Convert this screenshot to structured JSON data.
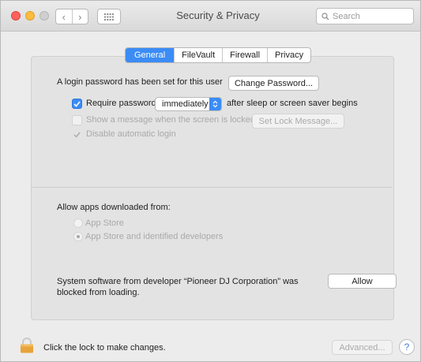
{
  "window": {
    "title": "Security & Privacy",
    "search_placeholder": "Search"
  },
  "tabs": [
    {
      "label": "General",
      "active": true
    },
    {
      "label": "FileVault",
      "active": false
    },
    {
      "label": "Firewall",
      "active": false
    },
    {
      "label": "Privacy",
      "active": false
    }
  ],
  "general": {
    "login_password_text": "A login password has been set for this user",
    "change_password_label": "Change Password...",
    "require_password": {
      "label": "Require password",
      "checked": true
    },
    "require_password_delay": "immediately",
    "after_sleep_text": "after sleep or screen saver begins",
    "show_message": {
      "label": "Show a message when the screen is locked",
      "checked": false,
      "enabled": false
    },
    "set_lock_message_label": "Set Lock Message...",
    "disable_auto_login": {
      "label": "Disable automatic login",
      "checked": true,
      "enabled": false
    }
  },
  "downloads": {
    "heading": "Allow apps downloaded from:",
    "options": [
      {
        "label": "App Store",
        "selected": false
      },
      {
        "label": "App Store and identified developers",
        "selected": true
      }
    ]
  },
  "blocked": {
    "line1": "System software from developer “Pioneer DJ Corporation” was",
    "line2": "blocked from loading.",
    "allow_label": "Allow"
  },
  "footer": {
    "lock_text": "Click the lock to make changes.",
    "advanced_label": "Advanced...",
    "help_label": "?"
  },
  "colors": {
    "accent": "#3b8cf5",
    "close": "#fc605c",
    "minimize": "#fdbc40",
    "lock": "#e8a33a"
  }
}
